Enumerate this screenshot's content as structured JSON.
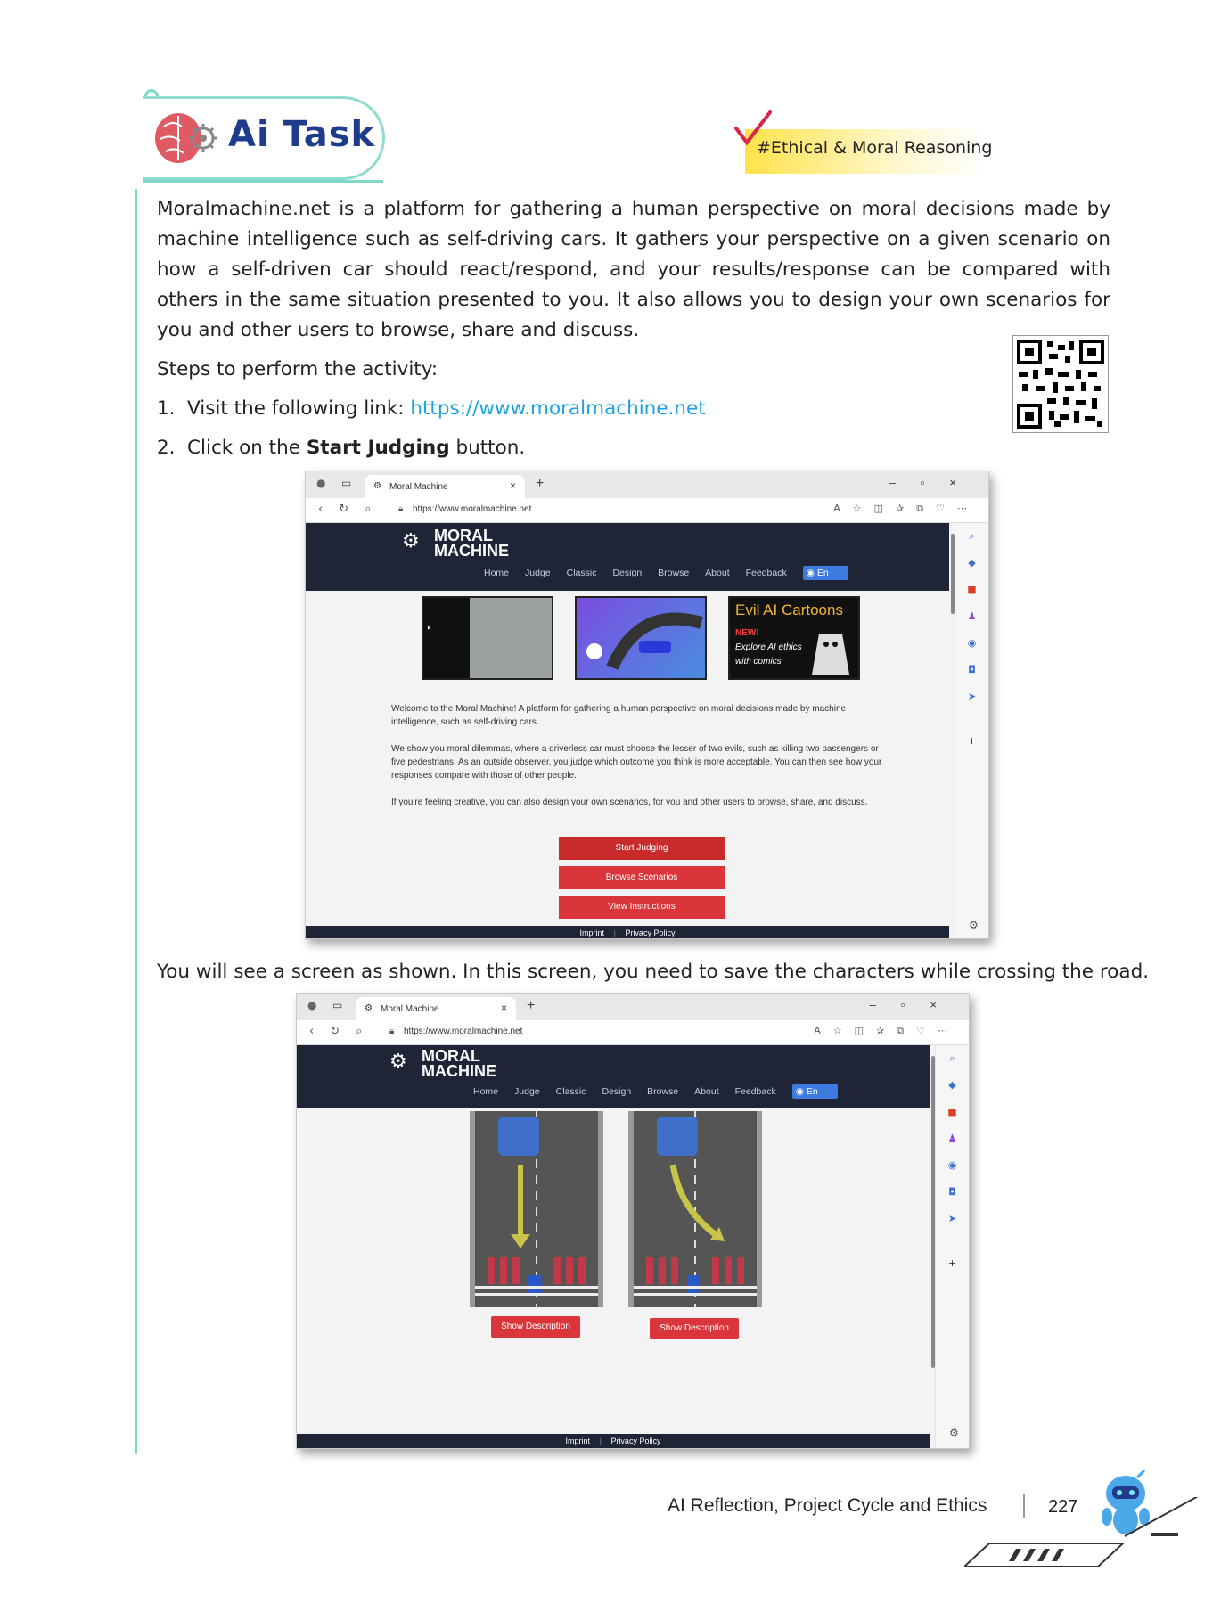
{
  "header": {
    "task_title": "Ai Task",
    "tag": "#Ethical & Moral Reasoning"
  },
  "intro": "Moralmachine.net is a platform for gathering a human perspective on moral decisions made by machine intelligence such as self-driving cars. It gathers your perspective on a given scenario on how a self-driven car should react/respond, and your results/response can be compared with others in the same situation presented to you. It also allows you to design your own scenarios for you and other users to browse, share and discuss.",
  "steps_heading": "Steps to perform the activity:",
  "steps": [
    {
      "num": "1.",
      "prefix": "Visit the following link: ",
      "link": "https://www.moralmachine.net"
    },
    {
      "num": "2.",
      "prefix": "Click on the ",
      "bold": "Start Judging",
      "suffix": " button."
    }
  ],
  "between_text": "You will see a screen as shown. In this screen, you need to save the characters while crossing the road.",
  "browser": {
    "tab_title": "Moral Machine",
    "url": "https://www.moralmachine.net"
  },
  "site": {
    "logo_line1": "MORAL",
    "logo_line2": "MACHINE",
    "nav": [
      "Home",
      "Judge",
      "Classic",
      "Design",
      "Browse",
      "About",
      "Feedback"
    ],
    "lang": "En",
    "banner3_title": "Evil AI Cartoons",
    "banner3_new": "NEW!",
    "banner3_sub1": "Explore AI ethics",
    "banner3_sub2": "with comics",
    "welcome_1": "Welcome to the Moral Machine! A platform for gathering a human perspective on moral decisions made by machine intelligence, such as self-driving cars.",
    "welcome_2": "We show you moral dilemmas, where a driverless car must choose the lesser of two evils, such as killing two passengers or five pedestrians. As an outside observer, you judge which outcome you think is more acceptable. You can then see how your responses compare with those of other people.",
    "welcome_3": "If you're feeling creative, you can also design your own scenarios, for you and other users to browse, share, and discuss.",
    "btn_start": "Start Judging",
    "btn_browse": "Browse Scenarios",
    "btn_instructions": "View Instructions",
    "footer_imprint": "Imprint",
    "footer_privacy": "Privacy Policy",
    "show_description": "Show Description"
  },
  "page_footer": {
    "chapter": "AI Reflection, Project Cycle and Ethics",
    "page": "227"
  },
  "colors": {
    "accent_teal": "#7fd8c8",
    "title_blue": "#1f3c8c",
    "tag_yellow": "#ffe24a",
    "link_blue": "#1aa3e0",
    "site_dark": "#1f2436",
    "button_red": "#d9353b"
  }
}
